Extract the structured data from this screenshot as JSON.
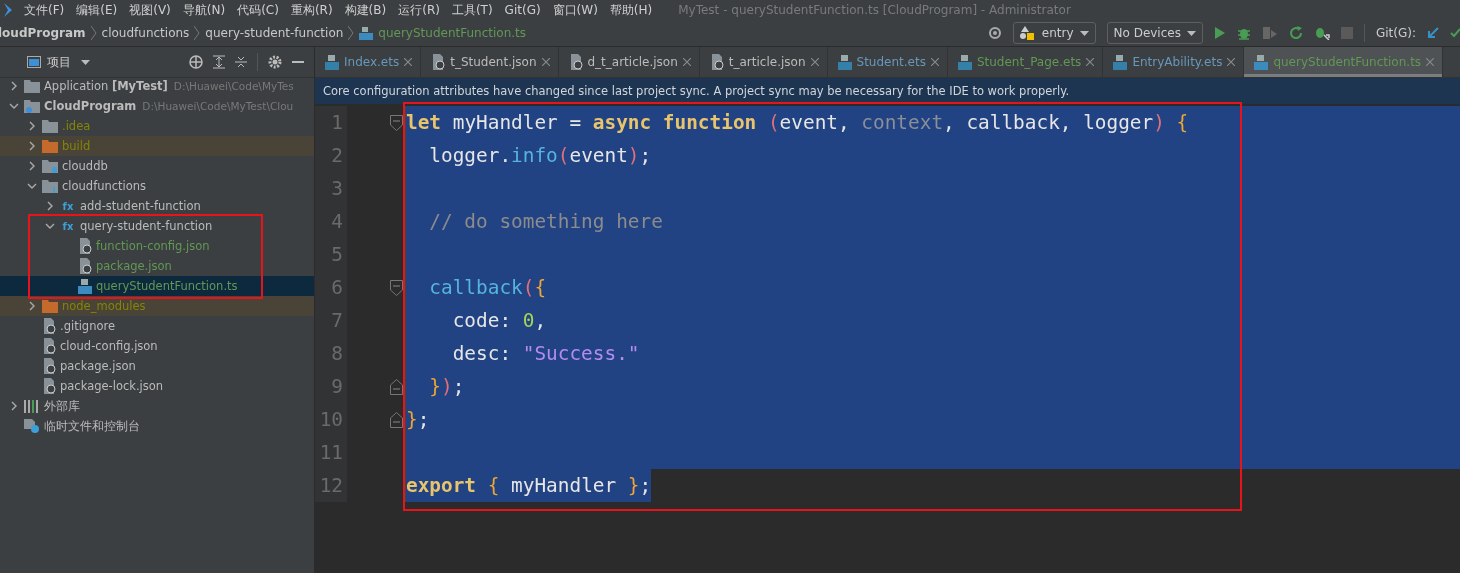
{
  "window": {
    "title": "MyTest - queryStudentFunction.ts [CloudProgram] - Administrator"
  },
  "menu": [
    "文件(F)",
    "编辑(E)",
    "视图(V)",
    "导航(N)",
    "代码(C)",
    "重构(R)",
    "构建(B)",
    "运行(R)",
    "工具(T)",
    "Git(G)",
    "窗口(W)",
    "帮助(H)"
  ],
  "breadcrumbs": [
    {
      "label": "loudProgram",
      "kind": "bold"
    },
    {
      "label": "cloudfunctions",
      "kind": "plain"
    },
    {
      "label": "query-student-function",
      "kind": "plain"
    },
    {
      "label": "queryStudentFunction.ts",
      "kind": "file"
    }
  ],
  "toolbar": {
    "config": "entry",
    "device": "No Devices",
    "git_label": "Git(G):"
  },
  "project_panel": {
    "title": "项目",
    "tree": [
      {
        "name": "Application **[MyTest]**",
        "path": "D:\\Huawei\\Code\\MyTes",
        "kind": "module",
        "color": "#bbbbbb",
        "excluded": false,
        "expanded": false,
        "selected": false
      },
      {
        "name": "**CloudProgram**",
        "path": "D:\\Huawei\\Code\\MyTest\\Clou",
        "kind": "cloud",
        "color": "#bbbbbb",
        "excluded": false,
        "expanded": true,
        "selected": false,
        "children": [
          {
            "name": ".idea",
            "kind": "folder",
            "color": "#848504",
            "excluded": false,
            "expanded": false,
            "selected": false
          },
          {
            "name": "build",
            "kind": "folder",
            "color": "#848504",
            "excluded": true,
            "expanded": false,
            "selected": false
          },
          {
            "name": "clouddb",
            "kind": "db",
            "color": "#bbbbbb",
            "excluded": false,
            "expanded": false,
            "selected": false
          },
          {
            "name": "cloudfunctions",
            "kind": "functions",
            "color": "#bbbbbb",
            "excluded": false,
            "expanded": true,
            "selected": false,
            "children": [
              {
                "name": "add-student-function",
                "badge": "fx",
                "kind": "function",
                "color": "#bbbbbb",
                "excluded": false,
                "expanded": false,
                "selected": false
              },
              {
                "name": "query-student-function",
                "badge": "fx",
                "kind": "function",
                "color": "#bbbbbb",
                "excluded": false,
                "expanded": true,
                "selected": false,
                "children": [
                  {
                    "name": "function-config.json",
                    "kind": "json",
                    "color": "#629755",
                    "excluded": false,
                    "selected": false
                  },
                  {
                    "name": "package.json",
                    "kind": "json",
                    "color": "#629755",
                    "excluded": false,
                    "selected": false
                  },
                  {
                    "name": "queryStudentFunction.ts",
                    "kind": "ts",
                    "color": "#629755",
                    "excluded": false,
                    "selected": true
                  }
                ]
              }
            ]
          },
          {
            "name": "node_modules",
            "kind": "folder",
            "color": "#848504",
            "excluded": true,
            "expanded": false,
            "selected": false
          },
          {
            "name": ".gitignore",
            "kind": "ignore",
            "color": "#bbbbbb",
            "excluded": false,
            "selected": false
          },
          {
            "name": "cloud-config.json",
            "kind": "json",
            "color": "#bbbbbb",
            "excluded": false,
            "selected": false
          },
          {
            "name": "package.json",
            "kind": "json",
            "color": "#bbbbbb",
            "excluded": false,
            "selected": false
          },
          {
            "name": "package-lock.json",
            "kind": "json",
            "color": "#bbbbbb",
            "excluded": false,
            "selected": false
          }
        ]
      },
      {
        "name": "外部库",
        "kind": "library",
        "color": "#bbbbbb",
        "excluded": false,
        "expanded": false,
        "selected": false
      },
      {
        "name": "临时文件和控制台",
        "kind": "scratch",
        "color": "#bbbbbb",
        "excluded": false,
        "selected": false
      }
    ]
  },
  "tabs": [
    {
      "label": "Index.ets",
      "kind": "ets",
      "color": "#6897bb",
      "selected": false
    },
    {
      "label": "t_Student.json",
      "kind": "json",
      "color": "#bbbbbb",
      "selected": false
    },
    {
      "label": "d_t_article.json",
      "kind": "json",
      "color": "#bbbbbb",
      "selected": false
    },
    {
      "label": "t_article.json",
      "kind": "json",
      "color": "#bbbbbb",
      "selected": false
    },
    {
      "label": "Student.ets",
      "kind": "ets",
      "color": "#6897bb",
      "selected": false
    },
    {
      "label": "Student_Page.ets",
      "kind": "ets",
      "color": "#629755",
      "selected": false
    },
    {
      "label": "EntryAbility.ets",
      "kind": "ets",
      "color": "#6897bb",
      "selected": false
    },
    {
      "label": "queryStudentFunction.ts",
      "kind": "ts",
      "color": "#629755",
      "selected": true
    }
  ],
  "notification": "Core configuration attributes have changed since last project sync. A project sync may be necessary for the IDE to work properly.",
  "editor": {
    "lines": [
      {
        "number": "1",
        "kind": "fold-start",
        "selected": true,
        "tokens": [
          {
            "kind": "kw",
            "t": "let"
          },
          {
            "kind": "plain",
            "t": " myHandler = "
          },
          {
            "kind": "kw",
            "t": "async function "
          },
          {
            "kind": "paren",
            "t": "("
          },
          {
            "kind": "plain",
            "t": "event, "
          },
          {
            "kind": "dim",
            "t": "context"
          },
          {
            "kind": "plain",
            "t": ", callback, logger"
          },
          {
            "kind": "paren",
            "t": ") "
          },
          {
            "kind": "brace",
            "t": "{"
          }
        ]
      },
      {
        "number": "2",
        "kind": "code",
        "selected": true,
        "tokens": [
          {
            "kind": "plain",
            "t": "  logger."
          },
          {
            "kind": "method",
            "t": "info"
          },
          {
            "kind": "paren",
            "t": "("
          },
          {
            "kind": "plain",
            "t": "event"
          },
          {
            "kind": "paren",
            "t": ")"
          },
          {
            "kind": "plain",
            "t": ";"
          }
        ]
      },
      {
        "number": "3",
        "kind": "code",
        "selected": true
      },
      {
        "number": "4",
        "kind": "code",
        "selected": true,
        "tokens": [
          {
            "kind": "comment",
            "t": "  // do something here"
          }
        ]
      },
      {
        "number": "5",
        "kind": "code",
        "selected": true
      },
      {
        "number": "6",
        "kind": "fold-start",
        "selected": true,
        "tokens": [
          {
            "kind": "method",
            "t": "  callback"
          },
          {
            "kind": "paren",
            "t": "("
          },
          {
            "kind": "brace",
            "t": "{"
          }
        ]
      },
      {
        "number": "7",
        "kind": "code",
        "selected": true,
        "tokens": [
          {
            "kind": "plain",
            "t": "    code: "
          },
          {
            "kind": "number",
            "t": "0"
          },
          {
            "kind": "plain",
            "t": ","
          }
        ]
      },
      {
        "number": "8",
        "kind": "code",
        "selected": true,
        "tokens": [
          {
            "kind": "plain",
            "t": "    desc: "
          },
          {
            "kind": "string",
            "t": "\"Success.\""
          }
        ]
      },
      {
        "number": "9",
        "kind": "fold-end",
        "selected": true,
        "tokens": [
          {
            "kind": "brace",
            "t": "  }"
          },
          {
            "kind": "paren",
            "t": ")"
          },
          {
            "kind": "plain",
            "t": ";"
          }
        ]
      },
      {
        "number": "10",
        "kind": "fold-end",
        "selected": true,
        "tokens": [
          {
            "kind": "brace",
            "t": "}"
          },
          {
            "kind": "plain",
            "t": ";"
          }
        ]
      },
      {
        "number": "11",
        "kind": "code",
        "selected": true
      },
      {
        "number": "12",
        "kind": "code",
        "selected": true,
        "tokens": [
          {
            "kind": "kw",
            "t": "export "
          },
          {
            "kind": "brace",
            "t": "{"
          },
          {
            "kind": "plain",
            "t": " myHandler "
          },
          {
            "kind": "brace",
            "t": "}"
          },
          {
            "kind": "plain",
            "t": ";"
          }
        ]
      }
    ]
  }
}
